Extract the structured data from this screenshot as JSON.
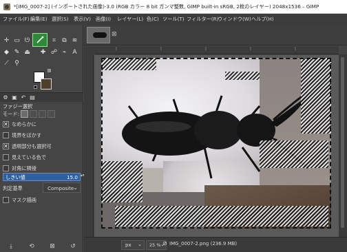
{
  "window": {
    "title": "*[IMG_0007-2] (インポートされた画像)-3.0 (RGB カラー 8 bit ガンマ整数, GIMP built-in sRGB, 2枚のレイヤー) 2048x1536 – GIMP"
  },
  "menu": {
    "items": [
      "ファイル(F)",
      "編集(E)",
      "選択(S)",
      "表示(V)",
      "画像(I)",
      "レイヤー(L)",
      "色(C)",
      "ツール(T)",
      "フィルター(R)",
      "ウィンドウ(W)",
      "ヘルプ(H)"
    ]
  },
  "toolbox": {
    "tools": [
      "move-tool",
      "rect-select-tool",
      "lasso-tool",
      "fuzzy-select-tool",
      "crop-tool",
      "unified-transform-tool",
      "warp-tool",
      "paint-bucket-tool",
      "paintbrush-tool",
      "eraser-tool",
      "clone-tool",
      "smudge-tool",
      "path-tool",
      "text-tool",
      "color-picker-tool",
      "zoom-tool"
    ],
    "active_tool": "fuzzy-select-tool",
    "fg_color": "#ffffff",
    "bg_color": "#4d3f2c"
  },
  "tool_options": {
    "title": "ファジー選択",
    "mode_label": "モード:",
    "options": [
      {
        "label": "なめらかに",
        "checked": true
      },
      {
        "label": "境界をぼかす",
        "checked": false
      },
      {
        "label": "透明部分も選択可",
        "checked": true
      },
      {
        "label": "見えている色で",
        "checked": false
      },
      {
        "label": "対角に隣接",
        "checked": false
      }
    ],
    "threshold_label": "しきい値",
    "threshold_value": "15.0",
    "criterion_label": "判定基準",
    "criterion_value": "Composite",
    "mask_label": "マスク描画",
    "mask_checked": false
  },
  "statusbar": {
    "unit": "px",
    "zoom": "25 %",
    "message": "IMG_0007-2.png (236.9 MB)"
  },
  "colors": {
    "accent_active_tool": "#2e8a3a",
    "threshold_bar": "#2f5f9e"
  }
}
